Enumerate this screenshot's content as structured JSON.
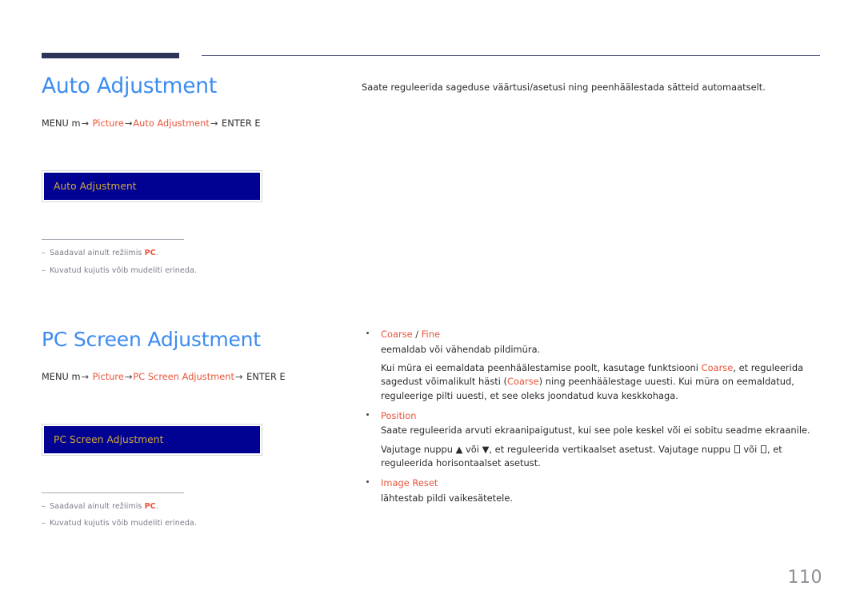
{
  "page": {
    "number": "110",
    "language_note": "Estonian display-manual page"
  },
  "sections": [
    {
      "id": "auto-adjustment",
      "title": "Auto Adjustment",
      "menu_path": {
        "prefix": "MENU m",
        "arrow": "→",
        "step1": "Picture",
        "step2": "Auto Adjustment",
        "suffix": "ENTER E"
      },
      "osd_label": "Auto Adjustment",
      "lead": "Saate reguleerida sageduse väärtusi/asetusi ning peenhäälestada sätteid automaatselt.",
      "notes": [
        {
          "dash": "–",
          "text_before": "Saadaval ainult režiimis ",
          "highlight": "PC",
          "text_after": "."
        },
        {
          "dash": "–",
          "text_before": "Kuvatud kujutis võib mudeliti erineda.",
          "highlight": "",
          "text_after": ""
        }
      ]
    },
    {
      "id": "pc-screen-adjustment",
      "title": "PC Screen Adjustment",
      "menu_path": {
        "prefix": "MENU m",
        "arrow": "→",
        "step1": "Picture",
        "step2": "PC Screen Adjustment",
        "suffix": "ENTER E"
      },
      "osd_label": "PC Screen Adjustment",
      "notes": [
        {
          "dash": "–",
          "text_before": "Saadaval ainult režiimis ",
          "highlight": "PC",
          "text_after": "."
        },
        {
          "dash": "–",
          "text_before": "Kuvatud kujutis võib mudeliti erineda.",
          "highlight": "",
          "text_after": ""
        }
      ]
    }
  ],
  "bullets": [
    {
      "title_part1": "Coarse",
      "title_sep": " / ",
      "title_part2": "Fine",
      "para1": "eemaldab või vähendab pildimüra.",
      "para2_a": "Kui müra ei eemaldata peenhäälestamise poolt, kasutage funktsiooni ",
      "para2_hl1": "Coarse",
      "para2_b": ", et reguleerida sagedust võimalikult hästi (",
      "para2_hl2": "Coarse",
      "para2_c": ") ning peenhäälestage uuesti. Kui müra on eemaldatud, reguleerige pilti uuesti, et see oleks joondatud kuva keskkohaga."
    },
    {
      "title_part1": "Position",
      "title_sep": "",
      "title_part2": "",
      "para1": "Saate reguleerida arvuti ekraanipaigutust, kui see pole keskel või ei sobitu seadme ekraanile.",
      "para2_a": "Vajutage nuppu ▲ või ▼, et reguleerida vertikaalset asetust. Vajutage nuppu ",
      "para2_hl1": "",
      "para2_b": " või ",
      "para2_hl2": "",
      "para2_c": ", et reguleerida horisontaalset asetust."
    },
    {
      "title_part1": "Image Reset",
      "title_sep": "",
      "title_part2": "",
      "para1": "lähtestab pildi vaikesätetele.",
      "para2_a": "",
      "para2_hl1": "",
      "para2_b": "",
      "para2_hl2": "",
      "para2_c": ""
    }
  ],
  "colors": {
    "heading_blue": "#3c8cf0",
    "accent_orange": "#e8543a",
    "osd_background": "#010291",
    "osd_text": "#d2a93c",
    "rule_navy": "#2e3457",
    "note_gray": "#7b7d8c",
    "page_number_gray": "#8e8e96"
  }
}
